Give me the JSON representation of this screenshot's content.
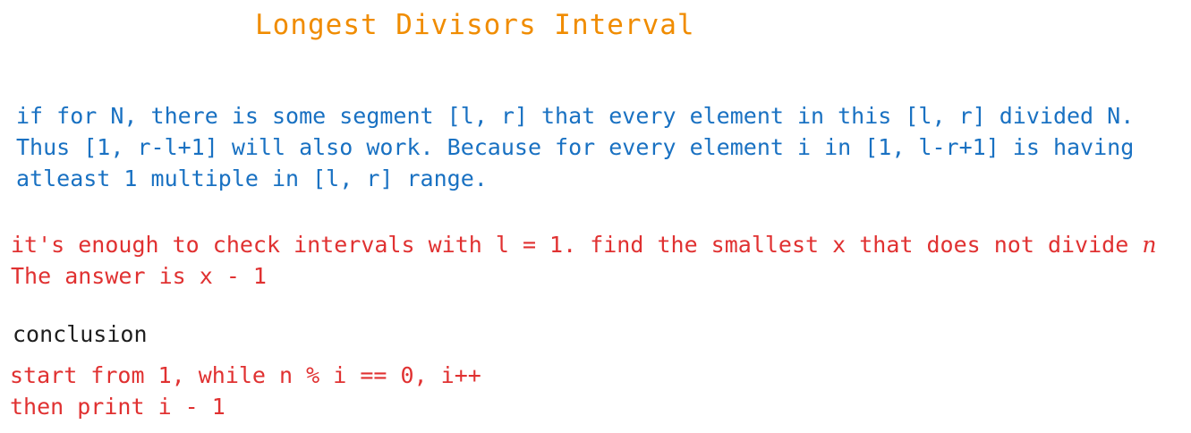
{
  "colors": {
    "title": "#f08c00",
    "blue": "#1971c2",
    "red": "#e03131",
    "black": "#1e1e1e"
  },
  "title": "Longest Divisors Interval",
  "explanation": {
    "lines": [
      "if for N, there is some segment [l, r] that every element in this [l, r] divided N.",
      "Thus [1, r-l+1] will also work. Because for every element i in [1, l-r+1] is having",
      "atleast 1 multiple in [l, r] range."
    ]
  },
  "insight": {
    "line1": "it's enough to check intervals with l = 1. find the smallest x that does not divide ",
    "line1_var": "n",
    "line2": "The answer is x - 1"
  },
  "conclusion": {
    "heading": "conclusion",
    "lines": [
      "start from 1, while n % i == 0, i++",
      "then print i - 1"
    ]
  }
}
